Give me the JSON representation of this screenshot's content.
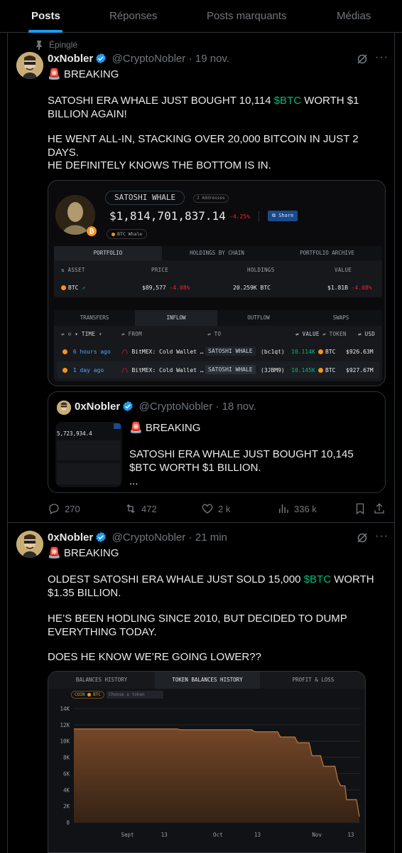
{
  "tabs": [
    "Posts",
    "Réponses",
    "Posts marquants",
    "Médias"
  ],
  "pinned_label": "Épinglé",
  "tweet1": {
    "name": "0xNobler",
    "handle": "@CryptoNobler",
    "time": "19 nov.",
    "siren": "🚨",
    "breaking": "BREAKING",
    "line1_pre": "SATOSHI ERA WHALE JUST BOUGHT 10,114 ",
    "line1_tag": "$BTC",
    "line1_post": " WORTH $1 BILLION AGAIN!",
    "line2": "HE WENT ALL-IN, STACKING OVER 20,000 BITCOIN IN JUST 2 DAYS.",
    "line3": "HE DEFINITELY KNOWS THE BOTTOM IS IN.",
    "card": {
      "entity_name": "SATOSHI WHALE",
      "addresses": "2 Addresses",
      "value": "$1,814,701,837.14",
      "change": "-4.25%",
      "share": "Share",
      "entity_tag": "BTC Whale",
      "tabs1": [
        "PORTFOLIO",
        "HOLDINGS BY CHAIN",
        "PORTFOLIO ARCHIVE"
      ],
      "cols1": [
        "ASSET",
        "PRICE",
        "HOLDINGS",
        "VALUE"
      ],
      "row1": {
        "asset": "BTC",
        "price": "$89,577",
        "price_change": "-4.08%",
        "holdings": "20.259K BTC",
        "value": "$1.81B",
        "value_change": "-4.08%"
      },
      "tabs2": [
        "TRANSFERS",
        "INFLOW",
        "OUTFLOW",
        "SWAPS"
      ],
      "cols2": [
        "TIME",
        "FROM",
        "TO",
        "VALUE",
        "TOKEN",
        "USD"
      ],
      "rows2": [
        {
          "time": "6 hours ago",
          "from": "BitMEX: Cold Wallet …",
          "to": "SATOSHI WHALE",
          "to_addr": "(bc1qt)",
          "value": "10.114K",
          "token": "BTC",
          "usd": "$926.63M"
        },
        {
          "time": "1 day ago",
          "from": "BitMEX: Cold Wallet …",
          "to": "SATOSHI WHALE",
          "to_addr": "(3JBM9)",
          "value": "10.145K",
          "token": "BTC",
          "usd": "$927.67M"
        }
      ]
    },
    "quote": {
      "name": "0xNobler",
      "handle": "@CryptoNobler",
      "time": "18 nov.",
      "thumb_value": "5,723,934.4",
      "breaking": "BREAKING",
      "text": "SATOSHI ERA WHALE JUST BOUGHT 10,145 $BTC WORTH $1 BILLION.",
      "ellipsis": "..."
    },
    "actions": {
      "replies": "270",
      "reposts": "472",
      "likes": "2 k",
      "views": "336 k"
    }
  },
  "tweet2": {
    "name": "0xNobler",
    "handle": "@CryptoNobler",
    "time": "21 min",
    "siren": "🚨",
    "breaking": "BREAKING",
    "line1_pre": "OLDEST SATOSHI ERA WHALE JUST SOLD 15,000 ",
    "line1_tag": "$BTC",
    "line1_post": " WORTH $1.35 BILLION.",
    "line2": "HE’S BEEN HODLING SINCE 2010, BUT DECIDED TO DUMP EVERYTHING TODAY.",
    "line3": "DOES HE KNOW WE’RE GOING LOWER??",
    "chart_tabs": [
      "BALANCES HISTORY",
      "TOKEN BALANCES HISTORY",
      "PROFIT & LOSS"
    ],
    "coin_label": "COIN",
    "coin_value": "BTC",
    "token_placeholder": "Choose a token"
  },
  "colors": {
    "accent": "#1d9bf0",
    "cashtag": "#00ba7c",
    "negative": "#f4212e",
    "chart_fill": "#7a4a2a"
  },
  "chart_data": {
    "type": "area",
    "title": "",
    "xlabel": "",
    "ylabel": "",
    "x_ticks": [
      "Sept",
      "13",
      "Oct",
      "13",
      "Nov",
      "13"
    ],
    "y_ticks": [
      "0",
      "2K",
      "4K",
      "6K",
      "8K",
      "10K",
      "12K",
      "14K"
    ],
    "ylim": [
      0,
      14000
    ],
    "series": [
      {
        "values": [
          [
            0,
            11500
          ],
          [
            0.36,
            11500
          ],
          [
            0.37,
            11400
          ],
          [
            0.62,
            11400
          ],
          [
            0.63,
            11150
          ],
          [
            0.71,
            11150
          ],
          [
            0.72,
            10500
          ],
          [
            0.77,
            10500
          ],
          [
            0.78,
            9800
          ],
          [
            0.82,
            9800
          ],
          [
            0.83,
            8200
          ],
          [
            0.86,
            8200
          ],
          [
            0.87,
            6900
          ],
          [
            0.91,
            6900
          ],
          [
            0.92,
            5200
          ],
          [
            0.93,
            4500
          ],
          [
            0.945,
            4500
          ],
          [
            0.95,
            2800
          ],
          [
            0.985,
            2800
          ],
          [
            0.995,
            700
          ]
        ]
      }
    ]
  }
}
